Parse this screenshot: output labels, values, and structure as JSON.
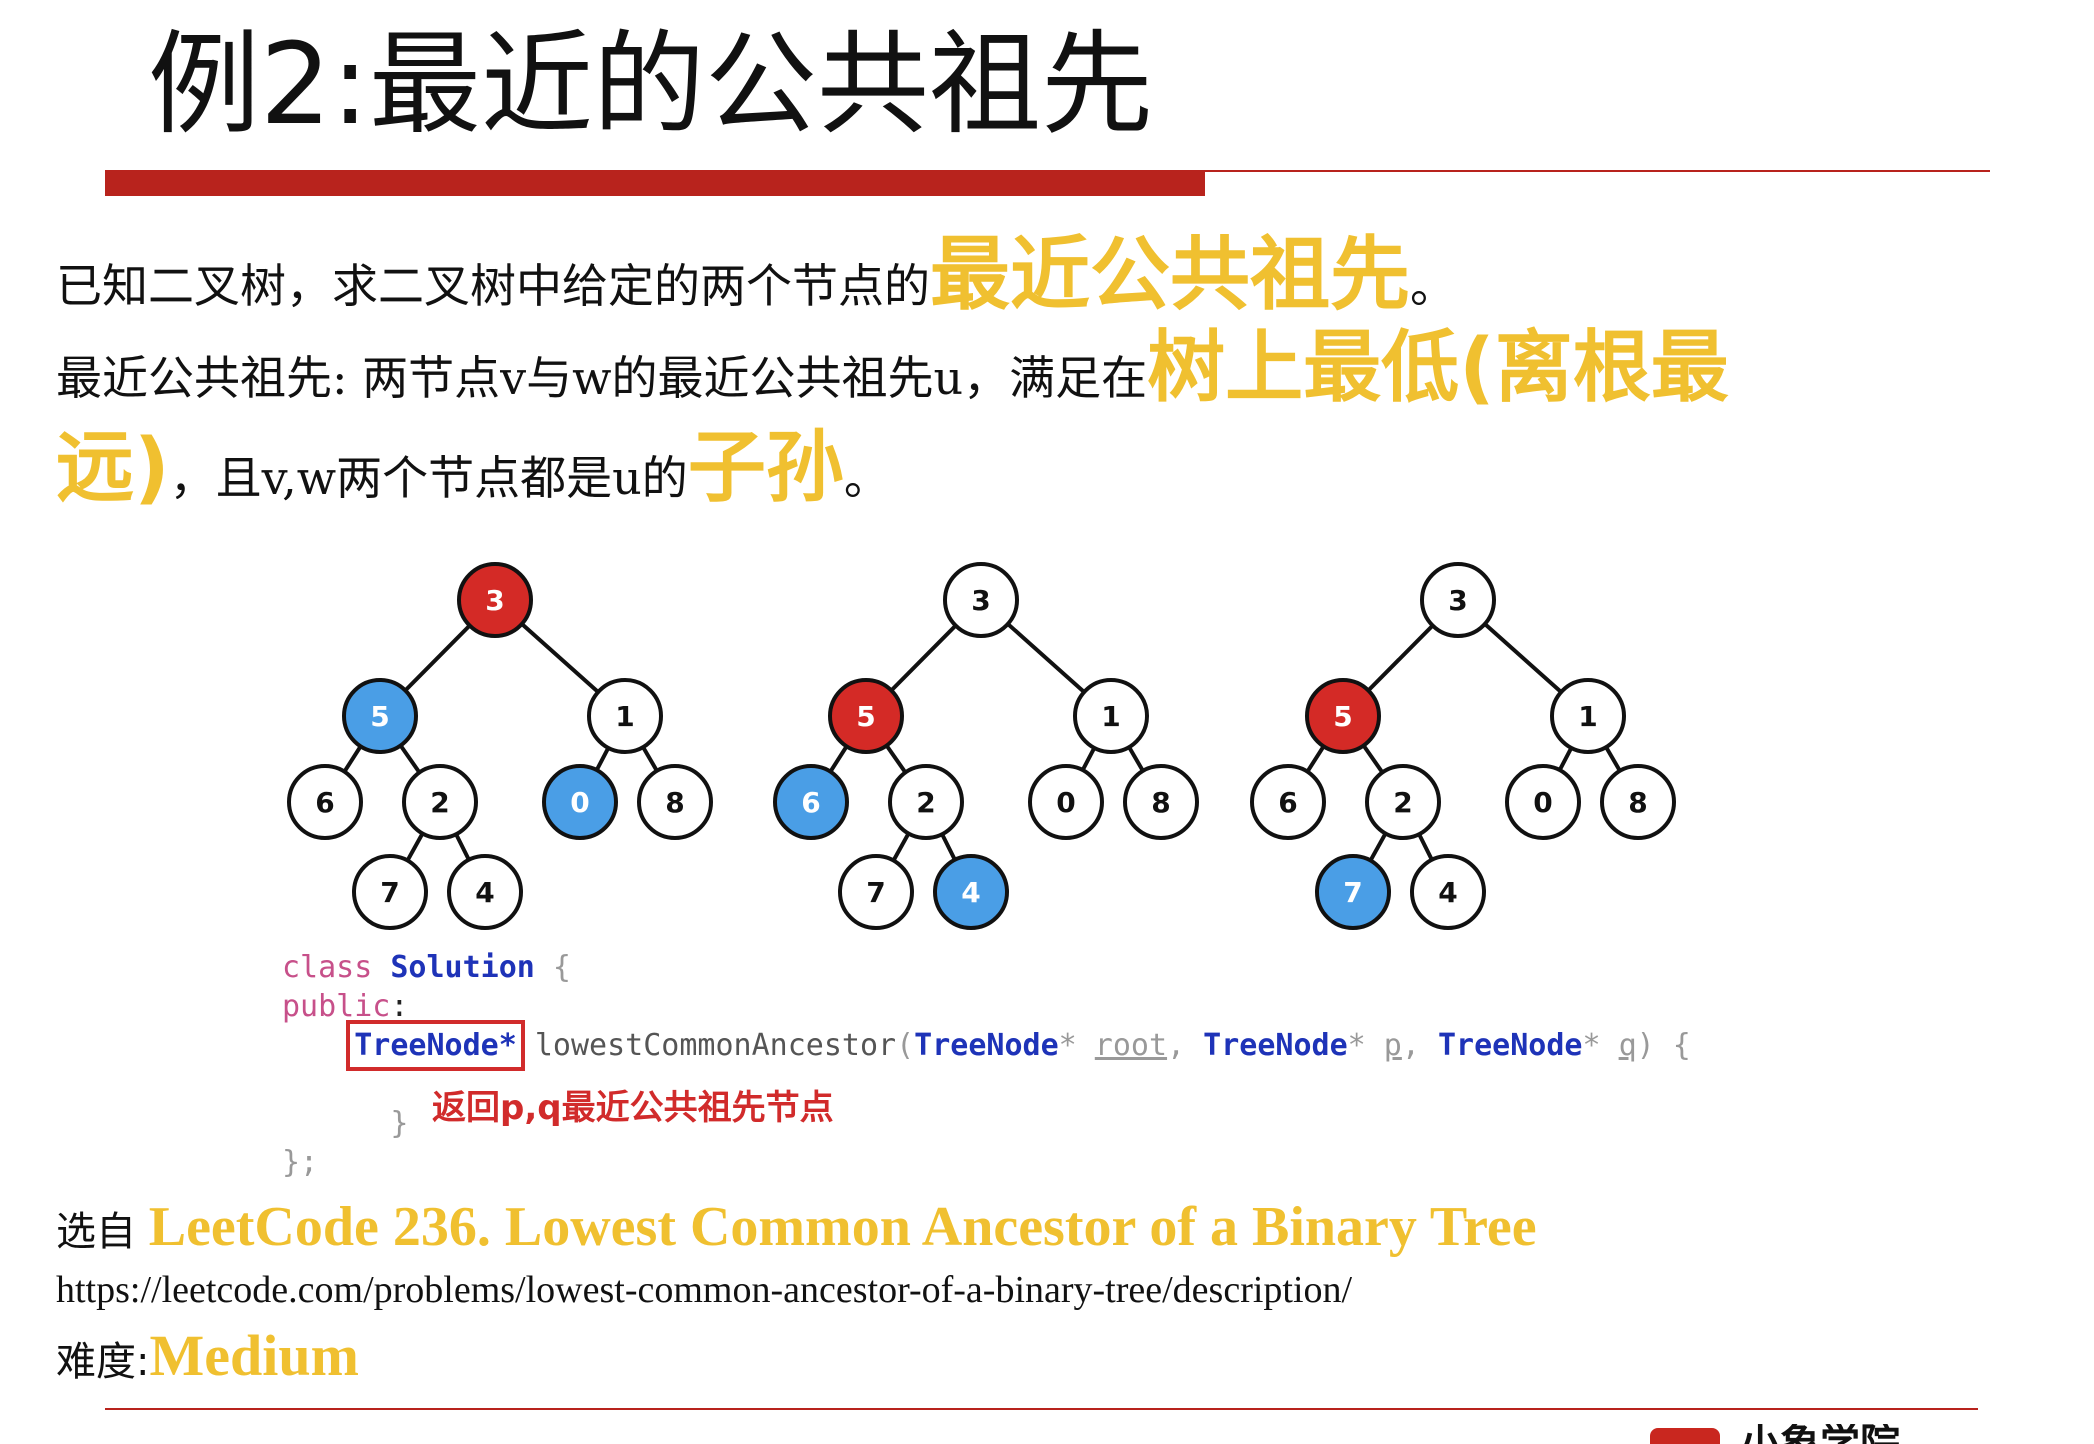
{
  "slide": {
    "title": "例2:最近的公共祖先",
    "line1": {
      "text": "已知二叉树，求二叉树中给定的两个节点的",
      "highlight": "最近公共祖先",
      "end": "。"
    },
    "line2": {
      "text": "最近公共祖先: 两节点v与w的最近公共祖先u，满足在",
      "highlight": "树上最低(离根最"
    },
    "line3": {
      "highlight1": "远)",
      "text": "，且v,w两个节点都是u的",
      "highlight2": "子孙",
      "end": "。"
    }
  },
  "trees": [
    {
      "nodes": [
        "3",
        "5",
        "1",
        "6",
        "2",
        "0",
        "8",
        "7",
        "4"
      ],
      "fills": [
        "red",
        "blue",
        "white",
        "white",
        "white",
        "blue",
        "white",
        "white",
        "white"
      ]
    },
    {
      "nodes": [
        "3",
        "5",
        "1",
        "6",
        "2",
        "0",
        "8",
        "7",
        "4"
      ],
      "fills": [
        "white",
        "red",
        "white",
        "blue",
        "white",
        "white",
        "white",
        "white",
        "blue"
      ]
    },
    {
      "nodes": [
        "3",
        "5",
        "1",
        "6",
        "2",
        "0",
        "8",
        "7",
        "4"
      ],
      "fills": [
        "white",
        "red",
        "white",
        "white",
        "white",
        "white",
        "white",
        "blue",
        "white"
      ]
    }
  ],
  "colors": {
    "red": "#d42a26",
    "blue": "#4a9ee6",
    "white": "#ffffff",
    "accent": "#f0c030",
    "bar": "#b8231d"
  },
  "code": {
    "kw_class": "class",
    "class_name": "Solution",
    "brace_open": " {",
    "kw_public": "public",
    "colon": ":",
    "ret_type": "TreeNode*",
    "fn_name": "lowestCommonAncestor",
    "paren_open": "(",
    "type1": "TreeNode",
    "star1": "* ",
    "param1": "root",
    "comma1": ", ",
    "type2": "TreeNode",
    "star2": "* ",
    "param2": "p",
    "comma2": ", ",
    "type3": "TreeNode",
    "star3": "* ",
    "param3": "q",
    "paren_close": ") {",
    "inner_close": "}",
    "class_close": "};"
  },
  "annotation": "返回p,q最近公共祖先节点",
  "source": {
    "prefix": "选自 ",
    "title": "LeetCode 236. Lowest Common Ancestor of a Binary Tree",
    "url": "https://leetcode.com/problems/lowest-common-ancestor-of-a-binary-tree/description/",
    "difficulty_label": "难度:",
    "difficulty": "Medium"
  },
  "footer": {
    "logo_text": "小象学院"
  }
}
